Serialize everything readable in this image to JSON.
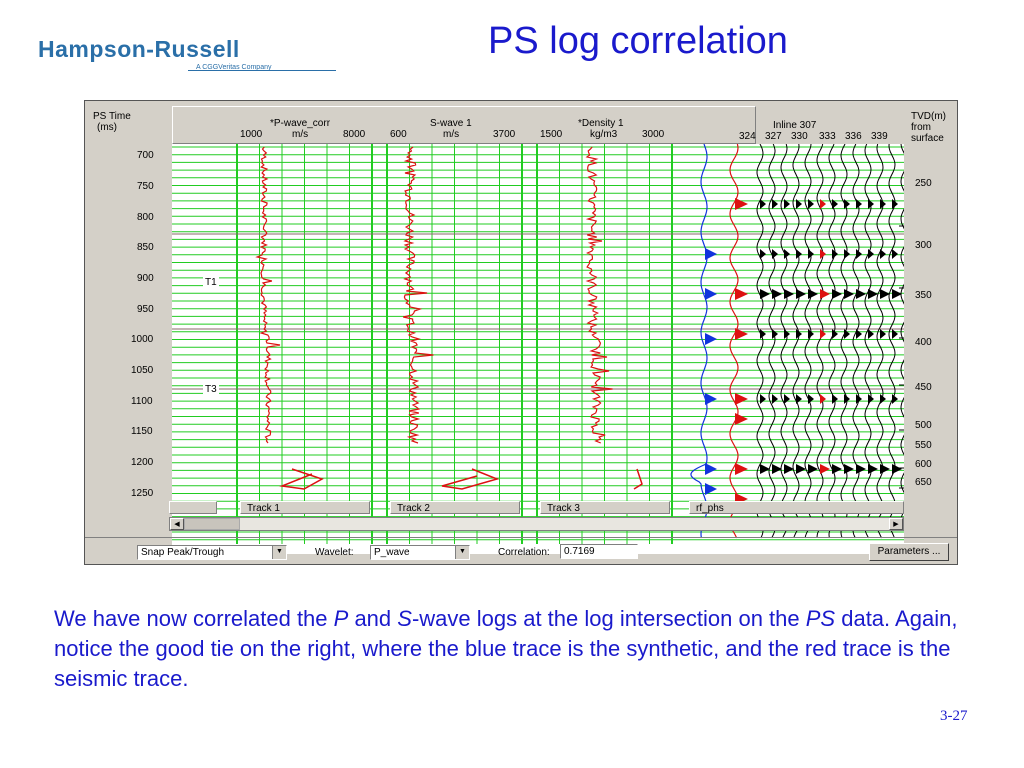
{
  "logo": {
    "text": "Hampson-Russell",
    "sub": "A CGGVeritas Company"
  },
  "slide_title": "PS log correlation",
  "app": {
    "left_axis": {
      "title": "PS Time",
      "unit": "(ms)",
      "ticks": [
        "700",
        "750",
        "800",
        "850",
        "900",
        "950",
        "1000",
        "1050",
        "1100",
        "1150",
        "1200",
        "1250"
      ]
    },
    "right_axis": {
      "title": "TVD(m)",
      "line2": "from",
      "line3": "surface",
      "ticks": [
        "250",
        "300",
        "350",
        "400",
        "450",
        "500",
        "550",
        "600",
        "650"
      ]
    },
    "logs": [
      {
        "name": "*P-wave_corr",
        "min": "1000",
        "unit": "m/s",
        "max": "8000"
      },
      {
        "name": "S-wave 1",
        "min": "600",
        "unit": "m/s",
        "max": "3700"
      },
      {
        "name": "*Density 1",
        "min": "1500",
        "unit": "kg/m3",
        "max": "3000"
      }
    ],
    "seismic_header": {
      "title": "Inline 307",
      "traces": [
        "324",
        "327",
        "330",
        "333",
        "336",
        "339"
      ]
    },
    "markers": [
      "T1",
      "T3"
    ],
    "tracks": [
      "Track 1",
      "Track 2",
      "Track 3",
      "rf_phs"
    ],
    "colors": {
      "grid": "#22cc22",
      "log": "#dd1111",
      "synthetic": "#1133dd",
      "seismic": "#dd1111",
      "wiggle": "#000000",
      "marker_line": "#8a6a6a"
    },
    "controls": {
      "snap_value": "Snap Peak/Trough",
      "wavelet_label": "Wavelet:",
      "wavelet_value": "P_wave",
      "correlation_label": "Correlation:",
      "correlation_value": "0.7169",
      "parameters_button": "Parameters ..."
    }
  },
  "caption": {
    "p1": "We have now correlated the ",
    "p_italic": "P",
    "p2": " and ",
    "s_italic": "S",
    "p3": "-wave logs at the log intersection on the ",
    "ps_italic": "PS",
    "p4": " data.  Again, notice the good tie on the right, where the blue trace is the synthetic, and the red trace is the seismic trace."
  },
  "page_number": "3-27"
}
